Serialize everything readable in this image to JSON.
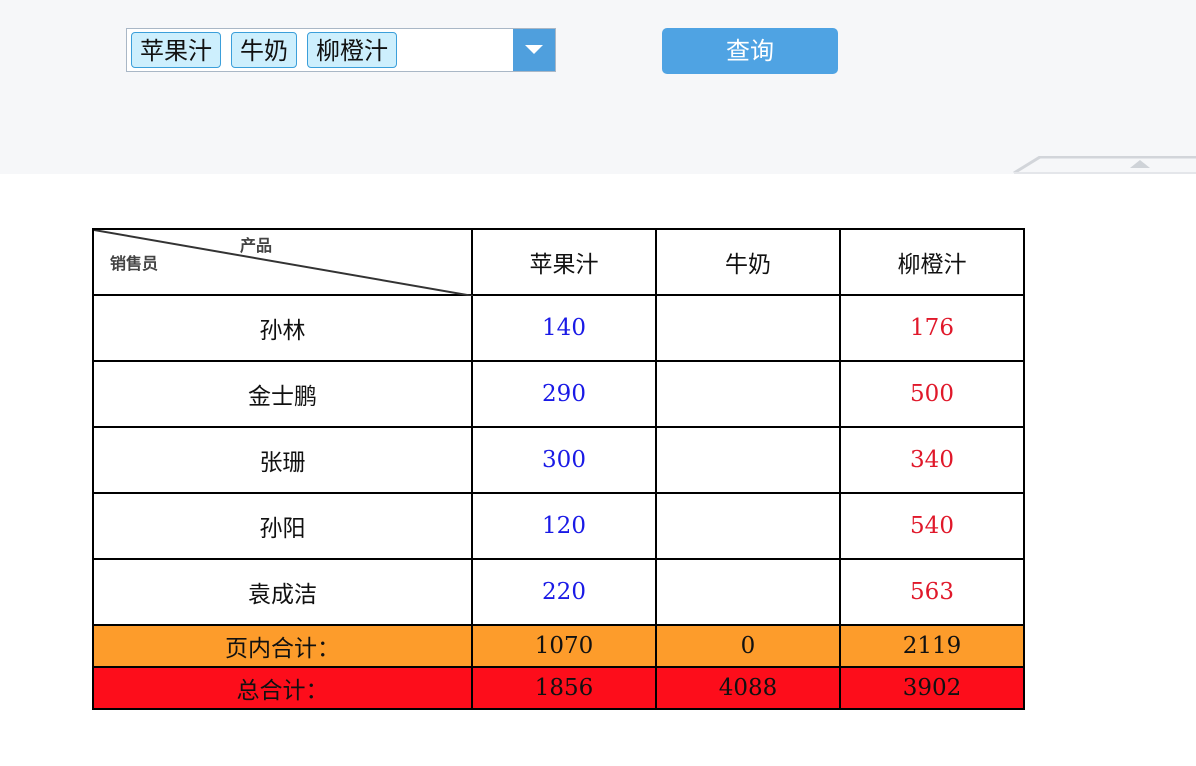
{
  "filter": {
    "selected_tags": [
      "苹果汁",
      "牛奶",
      "柳橙汁"
    ]
  },
  "toolbar": {
    "query_label": "查询"
  },
  "report": {
    "corner": {
      "column_axis_label": "产品",
      "row_axis_label": "销售员"
    },
    "columns": [
      "苹果汁",
      "牛奶",
      "柳橙汁"
    ],
    "rows": [
      {
        "name": "孙林",
        "values": [
          "140",
          "",
          "176"
        ]
      },
      {
        "name": "金士鹏",
        "values": [
          "290",
          "",
          "500"
        ]
      },
      {
        "name": "张珊",
        "values": [
          "300",
          "",
          "340"
        ]
      },
      {
        "name": "孙阳",
        "values": [
          "120",
          "",
          "540"
        ]
      },
      {
        "name": "袁成洁",
        "values": [
          "220",
          "",
          "563"
        ]
      }
    ],
    "page_subtotal": {
      "label": "页内合计：",
      "values": [
        "1070",
        "0",
        "2119"
      ]
    },
    "grand_total": {
      "label": "总合计：",
      "values": [
        "1856",
        "4088",
        "3902"
      ]
    }
  },
  "colors": {
    "accent": "#4fa3e3",
    "tag_bg": "#cdeffd",
    "value_blue": "#1a1ae6",
    "value_red": "#e0182a",
    "subtotal_bg": "#fd9c2b",
    "total_bg": "#fd0d1b"
  }
}
